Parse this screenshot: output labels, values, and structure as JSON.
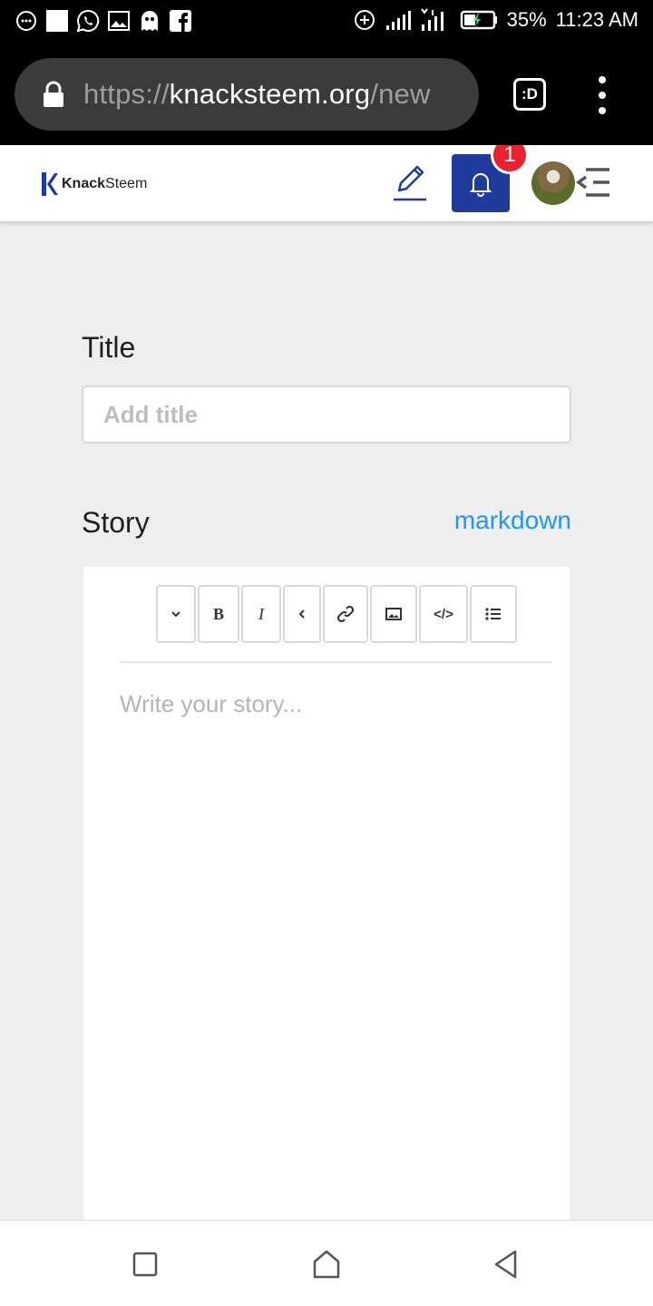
{
  "status_bar": {
    "battery_percent": "35%",
    "time": "11:23 AM",
    "left_icons": [
      "messenger-icon",
      "blank-square-icon",
      "whatsapp-icon",
      "gallery-icon",
      "ghost-icon",
      "facebook-icon"
    ],
    "right_icons": [
      "data-saver-icon",
      "signal-icon",
      "signal-icon-2",
      "battery-charging-icon"
    ]
  },
  "browser": {
    "url_scheme": "https://",
    "url_host": "knacksteem.org",
    "url_path": "/new",
    "tab_switcher_label": ":D"
  },
  "site_header": {
    "logo_bold": "Knack",
    "logo_light": "Steem",
    "notification_count": "1",
    "brand_color": "#1f3c9d",
    "badge_color": "#e8222e"
  },
  "form": {
    "title_label": "Title",
    "title_placeholder": "Add title",
    "title_value": "",
    "story_label": "Story",
    "markdown_link": "markdown",
    "story_placeholder": "Write your story...",
    "story_value": "",
    "link_color": "#2196f3"
  },
  "editor_toolbar": {
    "buttons": [
      {
        "name": "heading-dropdown",
        "icon": "chevron-down-icon"
      },
      {
        "name": "bold",
        "label": "B"
      },
      {
        "name": "italic",
        "label": "I"
      },
      {
        "name": "quote",
        "icon": "chevron-left-icon"
      },
      {
        "name": "link",
        "icon": "link-icon"
      },
      {
        "name": "image",
        "icon": "image-icon"
      },
      {
        "name": "code",
        "label": "</>"
      },
      {
        "name": "list",
        "icon": "list-icon"
      }
    ]
  },
  "nav_bar": {
    "buttons": [
      "recents-button",
      "home-button",
      "back-button"
    ]
  }
}
